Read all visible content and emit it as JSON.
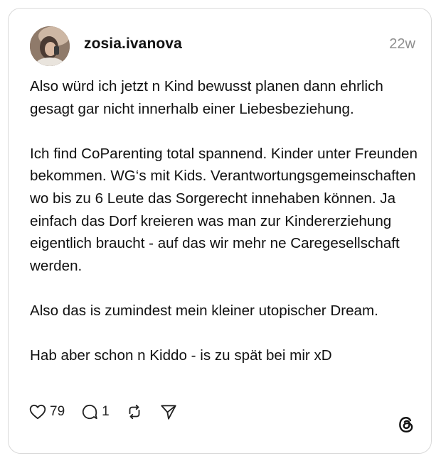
{
  "post": {
    "username": "zosia.ivanova",
    "timestamp": "22w",
    "paragraphs": [
      "Also würd ich jetzt n Kind bewusst planen dann ehrlich gesagt gar nicht innerhalb einer Liebesbeziehung.",
      "Ich find CoParenting total spannend. Kinder unter Freunden bekommen. WG‘s mit Kids. Verantwortungsgemeinschaften wo bis zu 6 Leute das Sorgerecht innehaben können. Ja einfach das Dorf kreieren was man zur Kindererziehung eigentlich braucht - auf das wir mehr ne Caregesellschaft werden.",
      "Also das is zumindest mein kleiner utopischer Dream.",
      "Hab aber schon n Kiddo - is zu spät bei mir xD"
    ],
    "likes": "79",
    "replies": "1"
  },
  "icons": {
    "like": "heart-icon",
    "reply": "comment-icon",
    "repost": "repost-icon",
    "share": "send-icon",
    "brand": "threads-logo-icon"
  },
  "colors": {
    "text": "#111111",
    "muted": "#8e8e8e",
    "border": "#d9d9d9"
  }
}
